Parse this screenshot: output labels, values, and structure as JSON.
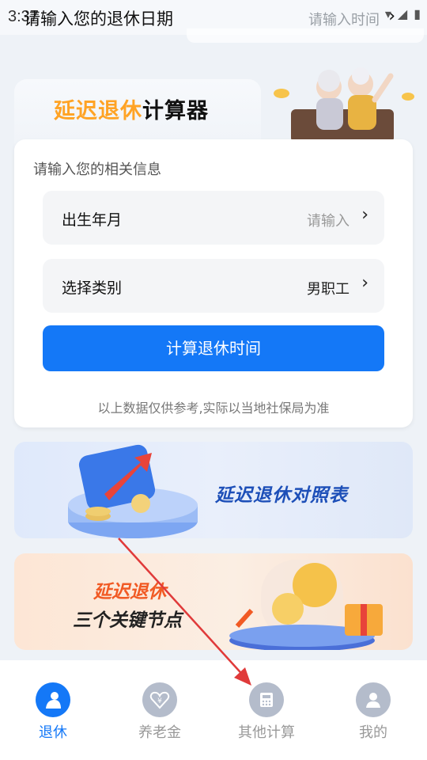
{
  "status_bar": {
    "time": "3:37"
  },
  "overlay": {
    "title": "请输入您的退休日期",
    "placeholder": "请输入时间"
  },
  "hero": {
    "title_highlight": "延迟退休",
    "title_rest": "计算器"
  },
  "form": {
    "label": "请输入您的相关信息",
    "birth": {
      "label": "出生年月",
      "value": "请输入"
    },
    "category": {
      "label": "选择类别",
      "value": "男职工"
    },
    "button": "计算退休时间",
    "disclaimer": "以上数据仅供参考,实际以当地社保局为准"
  },
  "banners": {
    "comparison": "延迟退休对照表",
    "nodes_line1": "延迟退休",
    "nodes_line2": "三个关键节点"
  },
  "nav": [
    {
      "label": "退休",
      "icon": "retire-icon",
      "active": true
    },
    {
      "label": "养老金",
      "icon": "pension-icon",
      "active": false
    },
    {
      "label": "其他计算",
      "icon": "calculator-icon",
      "active": false
    },
    {
      "label": "我的",
      "icon": "user-icon",
      "active": false
    }
  ],
  "colors": {
    "primary": "#1478f7",
    "accent": "#ffa325",
    "annotation": "#e03a3a"
  }
}
